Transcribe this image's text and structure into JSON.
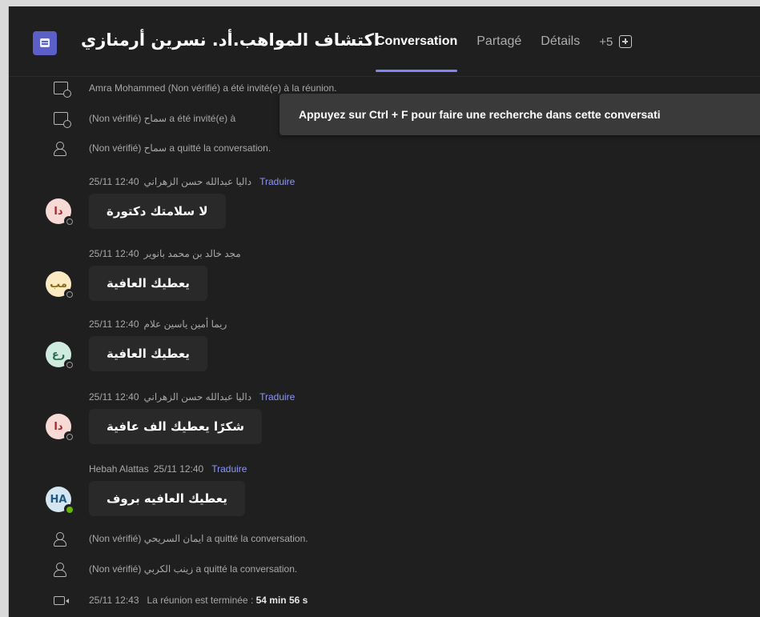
{
  "header": {
    "app_icon": "meeting-chat-icon",
    "title": "اكتشاف المواهب.أد. نسرين أرمنازي",
    "tabs": [
      {
        "label": "Conversation",
        "active": true
      },
      {
        "label": "Partagé",
        "active": false
      },
      {
        "label": "Détails",
        "active": false
      }
    ],
    "more_tabs": "+5",
    "add_tab_icon": "add-tab-icon"
  },
  "tooltip": {
    "text": "Appuyez sur Ctrl + F pour faire une recherche dans cette conversati"
  },
  "feed": {
    "system_top": [
      {
        "icon": "calendar-invite-icon",
        "text": "Amra Mohammed (Non vérifié) a été invité(e) à la réunion."
      },
      {
        "icon": "calendar-invite-icon",
        "text": "(Non vérifié) سماح a été invité(e) à"
      },
      {
        "icon": "person-left-icon",
        "text": "(Non vérifié) سماح a quitté la conversation."
      }
    ],
    "messages": [
      {
        "author": "داليا عبدالله حسن الزهراني",
        "time": "25/11 12:40",
        "translate": "Traduire",
        "avatar_initials": "دا",
        "avatar_bg": "#f7d9d6",
        "avatar_fg": "#a4262c",
        "status": "away",
        "text": "لا سلامتك دكتورة"
      },
      {
        "author": "مجد خالد بن محمد بانوير",
        "time": "25/11 12:40",
        "translate": "",
        "avatar_initials": "مب",
        "avatar_bg": "#fbeac2",
        "avatar_fg": "#8a6a1a",
        "status": "away",
        "text": "يعطيك العافية"
      },
      {
        "author": "ريما أمين ياسين علام",
        "time": "25/11 12:40",
        "translate": "",
        "avatar_initials": "رع",
        "avatar_bg": "#cfeadf",
        "avatar_fg": "#2b6a4f",
        "status": "away",
        "text": "يعطيك العافية"
      },
      {
        "author": "داليا عبدالله حسن الزهراني",
        "time": "25/11 12:40",
        "translate": "Traduire",
        "avatar_initials": "دا",
        "avatar_bg": "#f7d9d6",
        "avatar_fg": "#a4262c",
        "status": "away",
        "text": "شكرًا يعطيك الف عافية"
      },
      {
        "author": "Hebah Alattas",
        "time": "25/11 12:40",
        "translate": "Traduire",
        "avatar_initials": "HA",
        "avatar_bg": "#d4e6f1",
        "avatar_fg": "#215a84",
        "status": "online",
        "text": "يعطيك العافيه بروف"
      }
    ],
    "system_bottom": [
      {
        "icon": "person-left-icon",
        "text": "(Non vérifié) ايمان السريحي a quitté la conversation."
      },
      {
        "icon": "person-left-icon",
        "text": "(Non vérifié) زينب الكربي a quitté la conversation."
      }
    ],
    "meeting_end": {
      "icon": "meeting-ended-icon",
      "time": "25/11 12:43",
      "label": "La réunion est terminée :",
      "duration": "54 min 56 s"
    }
  }
}
